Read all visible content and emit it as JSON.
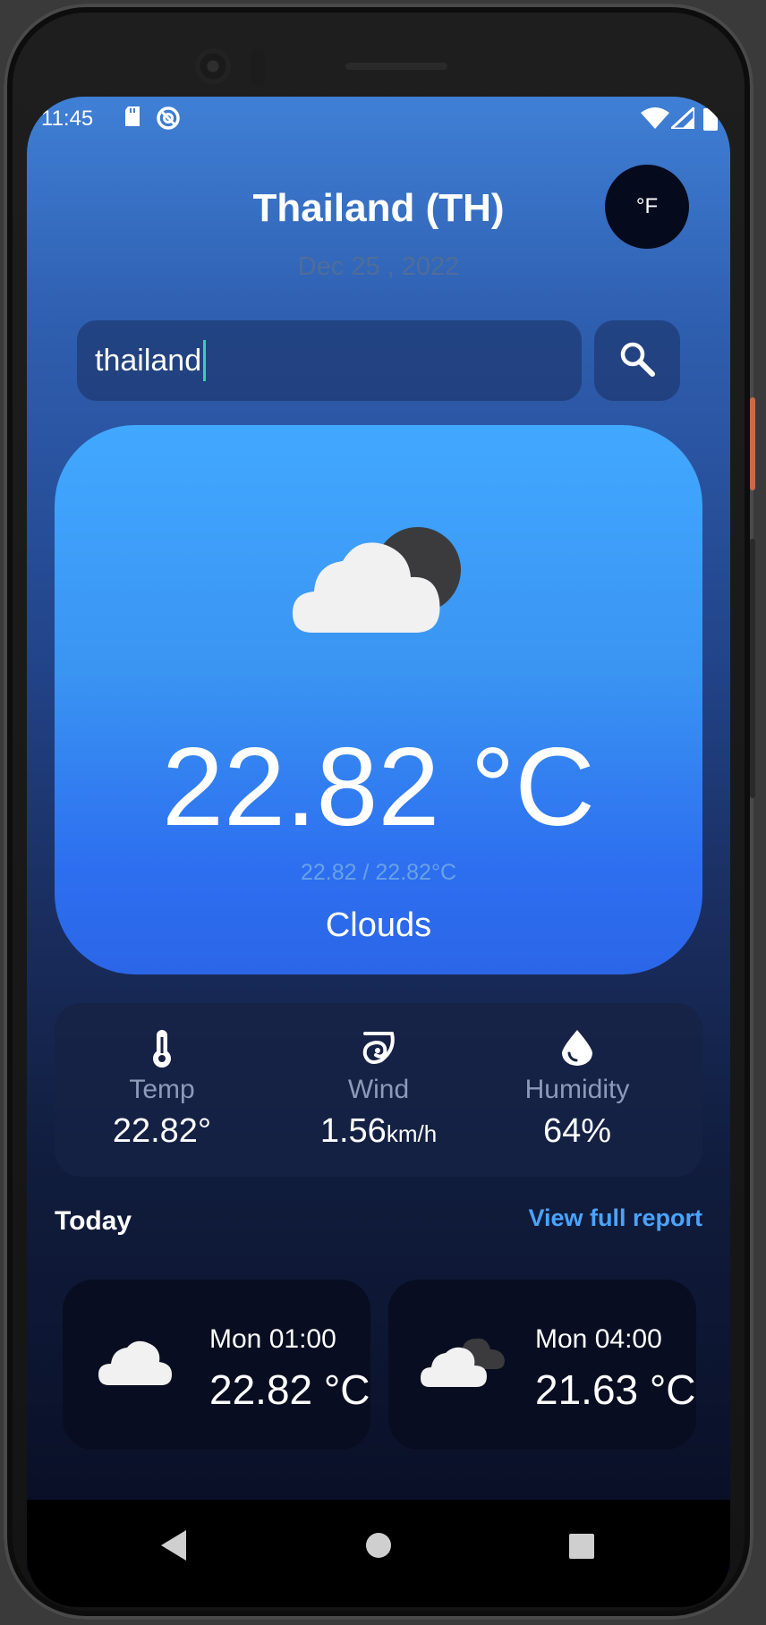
{
  "status_bar": {
    "time": "11:45",
    "left_icons": [
      "sd-card-icon",
      "sync-icon"
    ],
    "right_icons": [
      "wifi-icon",
      "signal-icon",
      "battery-icon"
    ]
  },
  "header": {
    "location": "Thailand (TH)",
    "date": "Dec 25 , 2022",
    "unit_toggle_label": "°F"
  },
  "search": {
    "value": "thailand",
    "button_icon": "search-icon"
  },
  "current": {
    "icon": "cloud-moon-icon",
    "temperature": "22.82 °C",
    "min_max": "22.82 / 22.82°C",
    "condition": "Clouds"
  },
  "stats": [
    {
      "icon": "thermometer-icon",
      "label": "Temp",
      "value": "22.82°",
      "unit": ""
    },
    {
      "icon": "wind-icon",
      "label": "Wind",
      "value": "1.56",
      "unit": "km/h"
    },
    {
      "icon": "droplet-icon",
      "label": "Humidity",
      "value": "64%",
      "unit": ""
    }
  ],
  "today": {
    "label": "Today",
    "link": "View full report",
    "hours": [
      {
        "icon": "cloud-icon",
        "time": "Mon 01:00",
        "temp": "22.82 °C"
      },
      {
        "icon": "clouds-icon",
        "time": "Mon 04:00",
        "temp": "21.63 °C"
      }
    ]
  },
  "nav": [
    "back-icon",
    "home-icon",
    "recents-icon"
  ],
  "colors": {
    "card_top": "#41a8ff",
    "card_bottom": "#2c66e8",
    "accent_link": "#4aa3ff",
    "caret": "#35d1b3"
  }
}
